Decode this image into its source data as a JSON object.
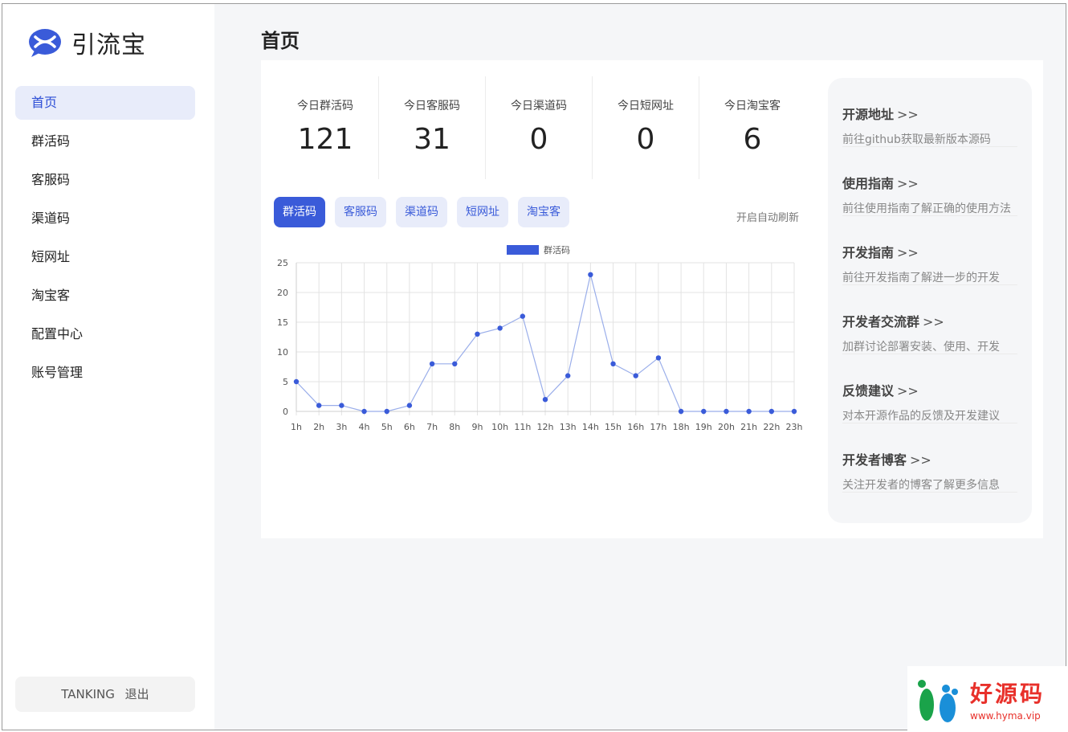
{
  "app": {
    "name": "引流宝"
  },
  "page": {
    "title": "首页"
  },
  "sidebar": {
    "items": [
      {
        "label": "首页"
      },
      {
        "label": "群活码"
      },
      {
        "label": "客服码"
      },
      {
        "label": "渠道码"
      },
      {
        "label": "短网址"
      },
      {
        "label": "淘宝客"
      },
      {
        "label": "配置中心"
      },
      {
        "label": "账号管理"
      }
    ],
    "active_index": 0,
    "user": {
      "name": "TANKING",
      "logout": "退出"
    }
  },
  "stats": [
    {
      "label": "今日群活码",
      "value": "121"
    },
    {
      "label": "今日客服码",
      "value": "31"
    },
    {
      "label": "今日渠道码",
      "value": "0"
    },
    {
      "label": "今日短网址",
      "value": "0"
    },
    {
      "label": "今日淘宝客",
      "value": "6"
    }
  ],
  "tabs": [
    "群活码",
    "客服码",
    "渠道码",
    "短网址",
    "淘宝客"
  ],
  "auto_refresh": "开启自动刷新",
  "chart_data": {
    "type": "line",
    "categories": [
      "1h",
      "2h",
      "3h",
      "4h",
      "5h",
      "6h",
      "7h",
      "8h",
      "9h",
      "10h",
      "11h",
      "12h",
      "13h",
      "14h",
      "15h",
      "16h",
      "17h",
      "18h",
      "19h",
      "20h",
      "21h",
      "22h",
      "23h"
    ],
    "series": [
      {
        "name": "群活码",
        "values": [
          5,
          1,
          1,
          0,
          0,
          1,
          8,
          8,
          13,
          14,
          16,
          2,
          6,
          23,
          8,
          6,
          9,
          0,
          0,
          0,
          0,
          0,
          0
        ]
      }
    ],
    "ylim": [
      0,
      25
    ],
    "yticks": [
      0,
      5,
      10,
      15,
      20,
      25
    ],
    "grid": true,
    "legend": "top-center",
    "color": "#3a5bd9"
  },
  "links": [
    {
      "title": "开源地址",
      "arrows": ">>",
      "desc": "前往github获取最新版本源码"
    },
    {
      "title": "使用指南",
      "arrows": ">>",
      "desc": "前往使用指南了解正确的使用方法"
    },
    {
      "title": "开发指南",
      "arrows": ">>",
      "desc": "前往开发指南了解进一步的开发"
    },
    {
      "title": "开发者交流群",
      "arrows": ">>",
      "desc": "加群讨论部署安装、使用、开发"
    },
    {
      "title": "反馈建议",
      "arrows": ">>",
      "desc": "对本开源作品的反馈及开发建议"
    },
    {
      "title": "开发者博客",
      "arrows": ">>",
      "desc": "关注开发者的博客了解更多信息"
    }
  ],
  "watermark": {
    "text": "好源码",
    "url": "www.hyma.vip"
  }
}
